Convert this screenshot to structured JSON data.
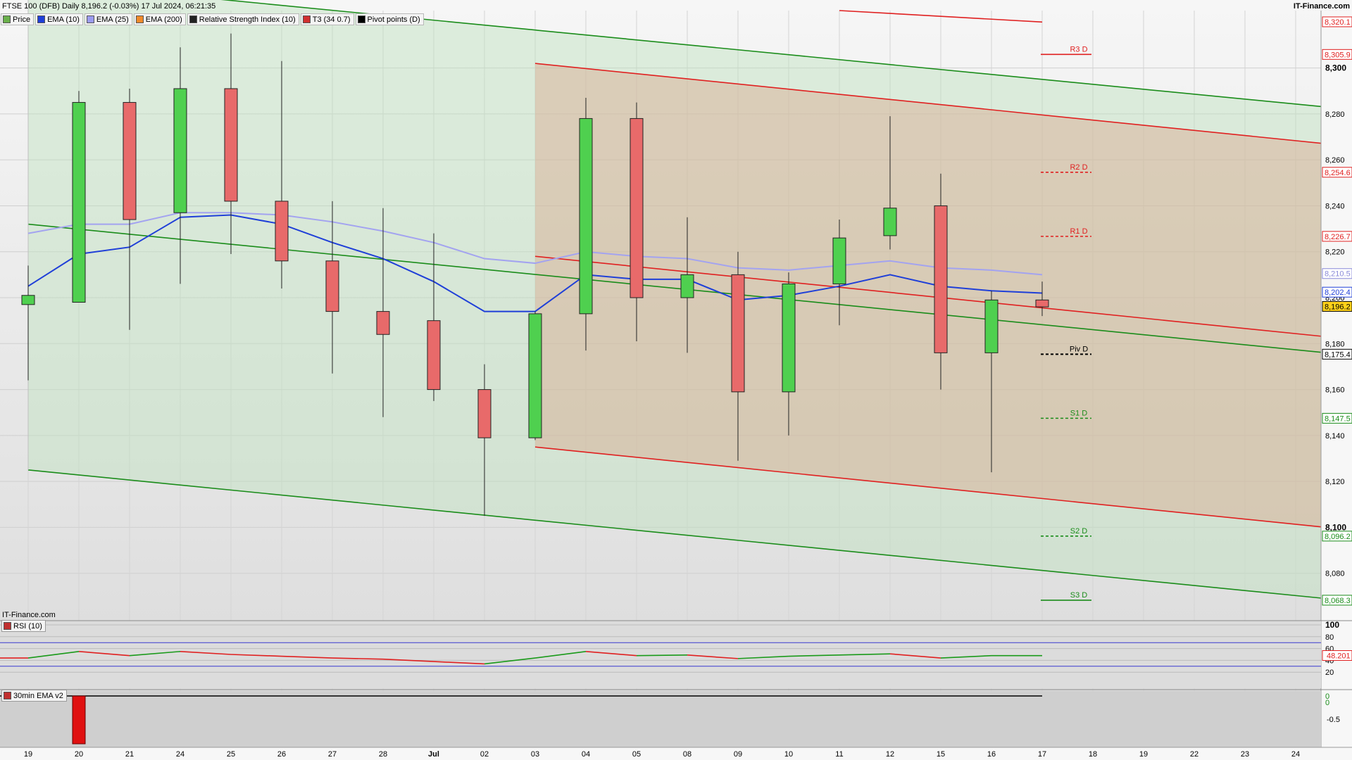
{
  "header": {
    "title": "FTSE 100 (DFB) Daily 8,196.2 (-0.03%) 17 Jul 2024, 06:21:35",
    "site": "IT-Finance.com",
    "watermark": "IT-Finance.com"
  },
  "legend": [
    {
      "label": "Price",
      "color": "#6ab04c"
    },
    {
      "label": "EMA (10)",
      "color": "#1f3fd8"
    },
    {
      "label": "EMA (25)",
      "color": "#9b9bf0"
    },
    {
      "label": "EMA (200)",
      "color": "#f08a2a"
    },
    {
      "label": "Relative Strength Index (10)",
      "color": "#222222"
    },
    {
      "label": "T3 (34 0.7)",
      "color": "#d03030"
    },
    {
      "label": "Pivot points (D)",
      "color": "#000000"
    }
  ],
  "rsi_panel": {
    "label": "RSI (10)",
    "value_label": "48.201",
    "levels": [
      100,
      80,
      60,
      40,
      20
    ]
  },
  "ema_panel": {
    "label": "30min EMA v2",
    "values": [
      "0",
      "0",
      "-0.5"
    ]
  },
  "colors": {
    "up": "#4fd04f",
    "down": "#e86a6a",
    "ema10": "#1f3fd8",
    "ema25": "#a3a3f0",
    "green_channel": "#1a8c1a",
    "red_channel": "#e02020"
  },
  "chart_data": {
    "type": "candlestick",
    "instrument": "FTSE 100 (DFB)",
    "ylim": [
      8060,
      8325
    ],
    "y_ticks": [
      "8,080",
      "8,100",
      "8,120",
      "8,140",
      "8,160",
      "8,180",
      "8,200",
      "8,220",
      "8,240",
      "8,260",
      "8,280",
      "8,300"
    ],
    "x_labels": [
      "19",
      "20",
      "21",
      "24",
      "25",
      "26",
      "27",
      "28",
      "Jul",
      "02",
      "03",
      "04",
      "05",
      "08",
      "09",
      "10",
      "11",
      "12",
      "15",
      "16",
      "17",
      "18",
      "19",
      "22",
      "23",
      "24"
    ],
    "candles": [
      {
        "label": "19",
        "open": 8197,
        "high": 8214,
        "low": 8164,
        "close": 8201
      },
      {
        "label": "20",
        "open": 8198,
        "high": 8290,
        "low": 8198,
        "close": 8285
      },
      {
        "label": "21",
        "open": 8285,
        "high": 8291,
        "low": 8186,
        "close": 8234
      },
      {
        "label": "24",
        "open": 8237,
        "high": 8309,
        "low": 8206,
        "close": 8291
      },
      {
        "label": "25",
        "open": 8291,
        "high": 8315,
        "low": 8219,
        "close": 8242
      },
      {
        "label": "26",
        "open": 8242,
        "high": 8303,
        "low": 8204,
        "close": 8216
      },
      {
        "label": "27",
        "open": 8216,
        "high": 8242,
        "low": 8167,
        "close": 8194
      },
      {
        "label": "28",
        "open": 8194,
        "high": 8239,
        "low": 8148,
        "close": 8184
      },
      {
        "label": "Jul",
        "open": 8190,
        "high": 8228,
        "low": 8155,
        "close": 8160
      },
      {
        "label": "02",
        "open": 8160,
        "high": 8171,
        "low": 8105,
        "close": 8139
      },
      {
        "label": "03",
        "open": 8139,
        "high": 8194,
        "low": 8138,
        "close": 8193
      },
      {
        "label": "04",
        "open": 8193,
        "high": 8287,
        "low": 8177,
        "close": 8278
      },
      {
        "label": "05",
        "open": 8278,
        "high": 8285,
        "low": 8181,
        "close": 8200
      },
      {
        "label": "08",
        "open": 8200,
        "high": 8235,
        "low": 8176,
        "close": 8210
      },
      {
        "label": "09",
        "open": 8210,
        "high": 8220,
        "low": 8129,
        "close": 8159
      },
      {
        "label": "10",
        "open": 8159,
        "high": 8211,
        "low": 8140,
        "close": 8206
      },
      {
        "label": "11",
        "open": 8206,
        "high": 8234,
        "low": 8188,
        "close": 8226
      },
      {
        "label": "12",
        "open": 8227,
        "high": 8279,
        "low": 8221,
        "close": 8239
      },
      {
        "label": "15",
        "open": 8240,
        "high": 8254,
        "low": 8160,
        "close": 8176
      },
      {
        "label": "16",
        "open": 8176,
        "high": 8203,
        "low": 8124,
        "close": 8199
      },
      {
        "label": "17",
        "open": 8199,
        "high": 8207,
        "low": 8192,
        "close": 8196
      }
    ],
    "ema10": [
      8205,
      8219,
      8222,
      8235,
      8236,
      8232,
      8224,
      8217,
      8207,
      8194,
      8194,
      8210,
      8208,
      8208,
      8199,
      8201,
      8205,
      8210,
      8205,
      8203,
      8202
    ],
    "ema25": [
      8228,
      8232,
      8232,
      8237,
      8237,
      8236,
      8233,
      8229,
      8224,
      8217,
      8215,
      8220,
      8218,
      8217,
      8213,
      8212,
      8214,
      8216,
      8213,
      8212,
      8210
    ],
    "price_labels": [
      {
        "value": 8320.1,
        "text": "8,320.1",
        "color": "#e02020",
        "fill": "#ffffff"
      },
      {
        "value": 8305.9,
        "text": "8,305.9",
        "color": "#e02020",
        "fill": "#ffffff"
      },
      {
        "value": 8254.6,
        "text": "8,254.6",
        "color": "#e02020",
        "fill": "#ffffff"
      },
      {
        "value": 8226.7,
        "text": "8,226.7",
        "color": "#e02020",
        "fill": "#ffffff"
      },
      {
        "value": 8210.5,
        "text": "8,210.5",
        "color": "#8a8ad8",
        "fill": "#ffffff"
      },
      {
        "value": 8202.4,
        "text": "8,202.4",
        "color": "#1f3fd8",
        "fill": "#ffffff"
      },
      {
        "value": 8196.2,
        "text": "8,196.2",
        "color": "#000000",
        "fill": "#ffd21a"
      },
      {
        "value": 8175.4,
        "text": "8,175.4",
        "color": "#000000",
        "fill": "#ffffff"
      },
      {
        "value": 8147.5,
        "text": "8,147.5",
        "color": "#1a8c1a",
        "fill": "#ffffff"
      },
      {
        "value": 8096.2,
        "text": "8,096.2",
        "color": "#1a8c1a",
        "fill": "#ffffff"
      },
      {
        "value": 8068.3,
        "text": "8,068.3",
        "color": "#1a8c1a",
        "fill": "#ffffff"
      }
    ],
    "pivots": [
      {
        "label": "R3 D",
        "value": 8305.9,
        "color": "#e02020",
        "dash": false
      },
      {
        "label": "R2 D",
        "value": 8254.6,
        "color": "#e02020",
        "dash": true
      },
      {
        "label": "R1 D",
        "value": 8226.7,
        "color": "#e02020",
        "dash": true
      },
      {
        "label": "Piv D",
        "value": 8175.4,
        "color": "#000000",
        "dash": true
      },
      {
        "label": "S1 D",
        "value": 8147.5,
        "color": "#1a8c1a",
        "dash": true
      },
      {
        "label": "S2 D",
        "value": 8096.2,
        "color": "#1a8c1a",
        "dash": true
      },
      {
        "label": "S3 D",
        "value": 8068.3,
        "color": "#1a8c1a",
        "dash": false
      }
    ],
    "channels": {
      "green": {
        "from_bar": 0,
        "upper": [
          8338,
          8283
        ],
        "mid": [
          8232,
          8176
        ],
        "lower": [
          8125,
          8069
        ],
        "to_bar": 25.6
      },
      "red": {
        "from_bar": 10,
        "upper": [
          8302,
          8267
        ],
        "mid": [
          8218,
          8183
        ],
        "lower": [
          8135,
          8100
        ],
        "to_bar": 25.6
      },
      "red_top": {
        "from": [
          16,
          8325
        ],
        "to": [
          20,
          8320
        ]
      }
    },
    "rsi": [
      44,
      55,
      48,
      55,
      50,
      47,
      44,
      42,
      38,
      34,
      44,
      55,
      48,
      49,
      43,
      47,
      49,
      51,
      44,
      48,
      48
    ],
    "ema_hist": [
      {
        "label": "20",
        "value": -0.55
      }
    ]
  }
}
